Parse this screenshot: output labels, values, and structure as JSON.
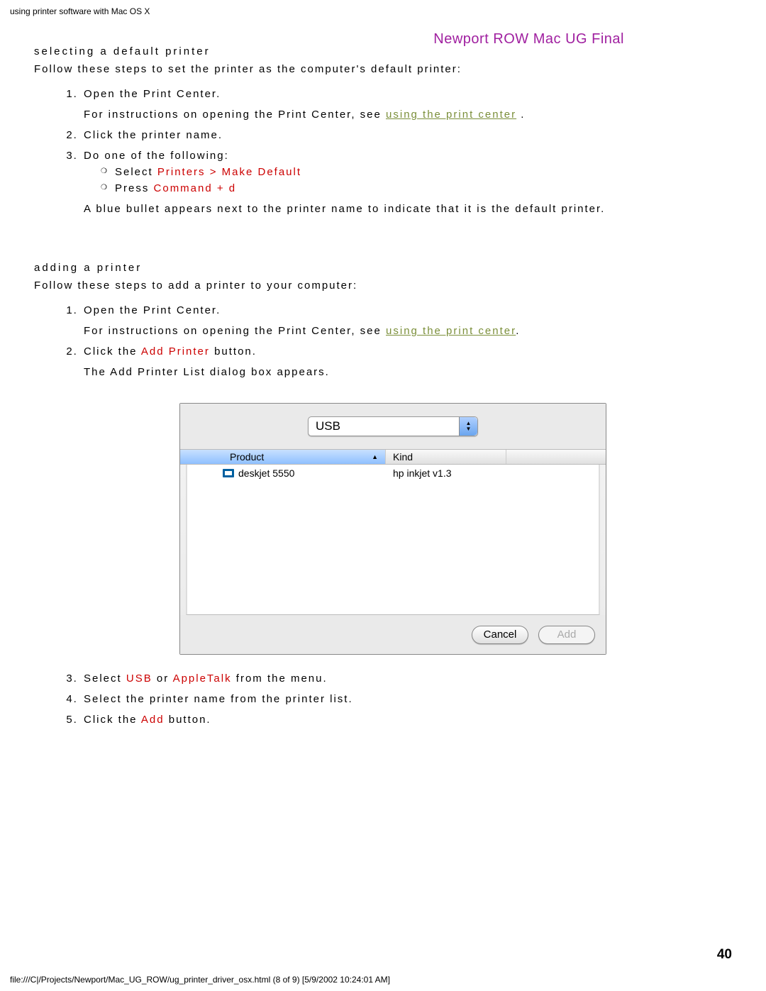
{
  "header": "using printer software with Mac OS X",
  "watermark": "Newport ROW Mac UG Final",
  "sec1": {
    "heading": "selecting a default printer",
    "intro": "Follow these steps to set the printer as the computer's default printer:",
    "step1_a": "Open the Print Center.",
    "step1_b_pre": "For instructions on opening the Print Center, see ",
    "step1_b_link": "using the print center",
    "step1_b_post": " .",
    "step2": "Click the printer name.",
    "step3": "Do one of the following:",
    "sub1_pre": "Select ",
    "sub1_red": "Printers > Make Default",
    "sub2_pre": "Press ",
    "sub2_red": "Command + d",
    "result": "A blue bullet appears next to the printer name to indicate that it is the default printer."
  },
  "sec2": {
    "heading": "adding a printer",
    "intro": "Follow these steps to add a printer to your computer:",
    "step1_a": "Open the Print Center.",
    "step1_b_pre": "For instructions on opening the Print Center, see ",
    "step1_b_link": "using the print center",
    "step1_b_post": ".",
    "step2_pre": "Click the ",
    "step2_red": "Add Printer",
    "step2_post": " button.",
    "step2_sub": "The Add Printer List dialog box appears.",
    "step3_pre": "Select ",
    "step3_red1": "USB",
    "step3_mid": " or ",
    "step3_red2": "AppleTalk",
    "step3_post": " from the menu.",
    "step4": "Select the printer name from the printer list.",
    "step5_pre": "Click the ",
    "step5_red": "Add",
    "step5_post": " button."
  },
  "dialog": {
    "popup": "USB",
    "col_product": "Product",
    "col_kind": "Kind",
    "row_product": "deskjet 5550",
    "row_kind": "hp inkjet v1.3",
    "btn_cancel": "Cancel",
    "btn_add": "Add"
  },
  "page_num": "40",
  "footer": "file:///C|/Projects/Newport/Mac_UG_ROW/ug_printer_driver_osx.html (8 of 9) [5/9/2002 10:24:01 AM]"
}
